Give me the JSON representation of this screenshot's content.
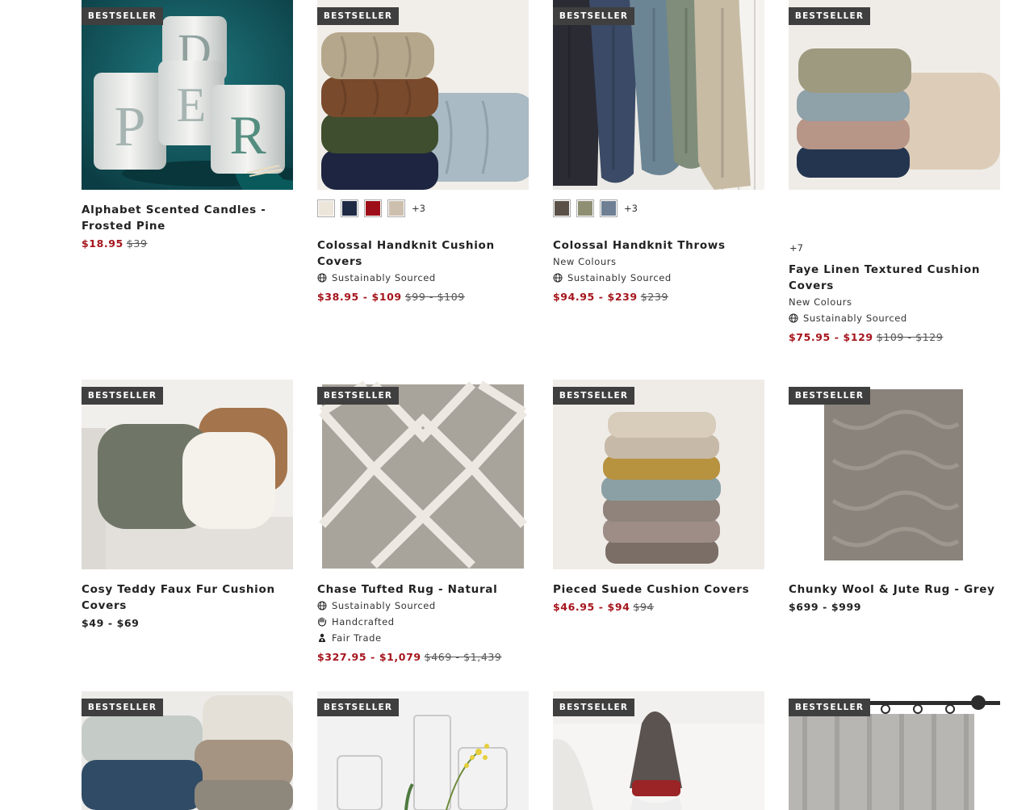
{
  "badge_label": "BESTSELLER",
  "products": [
    {
      "title": "Alphabet Scented Candles - Frosted Pine",
      "price_sale": "$18.95",
      "price_original": "$39"
    },
    {
      "title": "Colossal Handknit Cushion Covers",
      "swatches": [
        "#ece5da",
        "#1f2a45",
        "#9e0e18",
        "#cdbfae"
      ],
      "more_colours": "+3",
      "features": [
        "Sustainably Sourced"
      ],
      "price_sale": "$38.95 - $109",
      "price_original": "$99 - $109"
    },
    {
      "title": "Colossal Handknit Throws",
      "swatches": [
        "#5a5048",
        "#8e8e73",
        "#6f7f94"
      ],
      "more_colours": "+3",
      "subtitle": "New Colours",
      "features": [
        "Sustainably Sourced"
      ],
      "price_sale": "$94.95 - $239",
      "price_original": "$239"
    },
    {
      "title": "Faye Linen Textured Cushion Covers",
      "more_colours": "+7",
      "subtitle": "New Colours",
      "features": [
        "Sustainably Sourced"
      ],
      "price_sale": "$75.95 - $129",
      "price_original": "$109 - $129"
    },
    {
      "title": "Cosy Teddy Faux Fur Cushion Covers",
      "price_regular": "$49 - $69"
    },
    {
      "title": "Chase Tufted Rug - Natural",
      "features": [
        "Sustainably Sourced",
        "Handcrafted",
        "Fair Trade"
      ],
      "price_sale": "$327.95 - $1,079",
      "price_original": "$469 - $1,439"
    },
    {
      "title": "Pieced Suede Cushion Covers",
      "price_sale": "$46.95 - $94",
      "price_original": "$94"
    },
    {
      "title": "Chunky Wool & Jute Rug - Grey",
      "price_regular": "$699 - $999"
    }
  ],
  "colors": {
    "sale_price": "#a5141c",
    "badge_bg": "#3f3f3f"
  },
  "icons": {
    "sustainably_sourced": "globe-icon",
    "handcrafted": "hand-icon",
    "fair_trade": "fair-trade-icon"
  }
}
